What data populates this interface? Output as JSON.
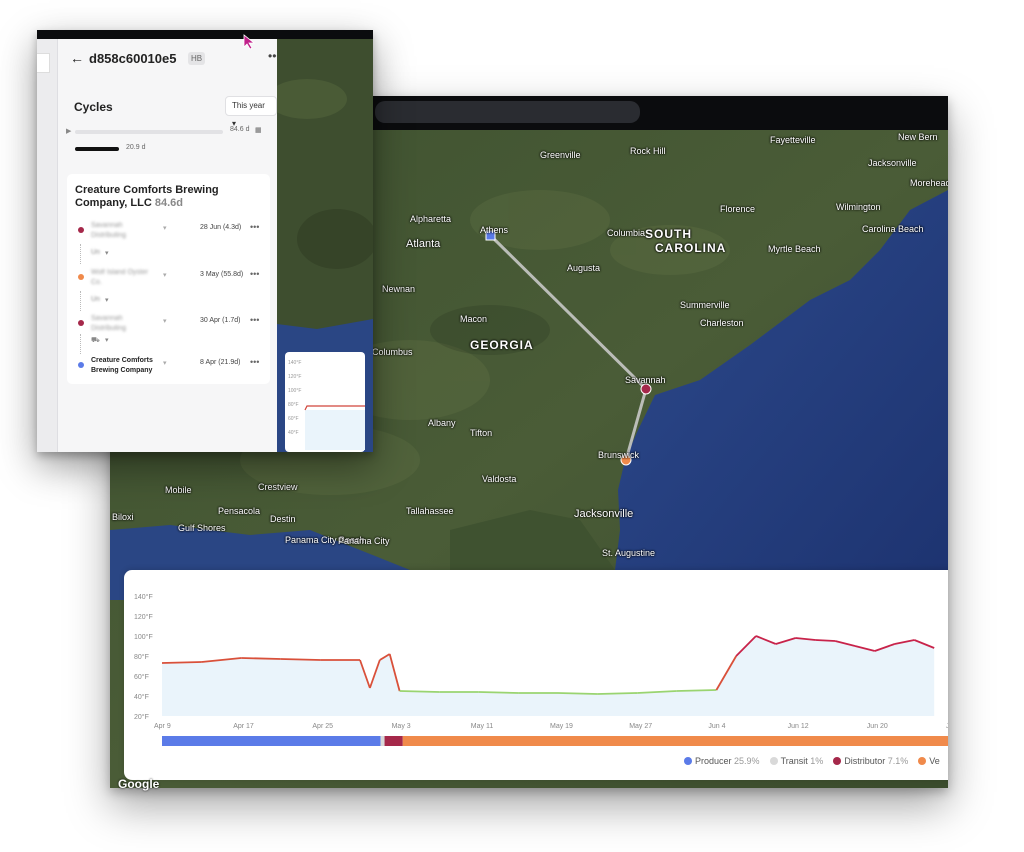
{
  "app": {
    "device_id": "d858c60010e5",
    "badge": "HB",
    "more_icon": "more-horizontal-icon",
    "back_icon": "arrow-left-icon"
  },
  "cycles": {
    "title": "Cycles",
    "period_select": "This year",
    "total_duration": "84.6 d",
    "progress_fraction": 1.0,
    "sub_duration": "20.9 d"
  },
  "company": {
    "name": "Creature Comforts Brewing Company, LLC",
    "days": "84.6d",
    "stops": [
      {
        "name": "Savannah Distributing",
        "date": "28 Jun (4.3d)",
        "color": "#a5284a",
        "blurred": true,
        "mode": "Un"
      },
      {
        "name": "Wolf Island Oyster Co.",
        "date": "3 May (55.8d)",
        "color": "#f08a4b",
        "blurred": true,
        "mode": "Un"
      },
      {
        "name": "Savannah Distributing",
        "date": "30 Apr (1.7d)",
        "color": "#a5284a",
        "blurred": true,
        "mode": "truck"
      },
      {
        "name": "Creature Comforts Brewing Company",
        "date": "8 Apr (21.9d)",
        "color": "#5b7be8",
        "blurred": false
      }
    ]
  },
  "mini_chart": {
    "y_ticks": [
      "140°F",
      "120°F",
      "100°F",
      "80°F",
      "60°F",
      "40°F"
    ]
  },
  "map": {
    "labels": {
      "states": [
        "SOUTH",
        "CAROLINA",
        "GEORGIA"
      ],
      "cities": [
        "Atlanta",
        "Athens",
        "Augusta",
        "Columbia",
        "Savannah",
        "Brunswick",
        "Jacksonville",
        "Tallahassee",
        "Macon",
        "Albany",
        "Tifton",
        "Valdosta",
        "Charleston",
        "Summerville",
        "Florence",
        "Wilmington",
        "Myrtle Beach",
        "Fayetteville",
        "Jacksonville",
        "Greenville",
        "Rock Hill",
        "Alpharetta",
        "Newnan",
        "Pensacola",
        "Mobile",
        "Destin",
        "Panama City Beach",
        "Panama City",
        "Gulf Shores",
        "Crestview",
        "St. Augustine",
        "Carolina Beach",
        "New Bern",
        "Morehead",
        "Biloxi",
        "Columbus"
      ],
      "google": "Google"
    }
  },
  "chart_data": {
    "type": "line",
    "title": "",
    "xlabel": "",
    "ylabel": "",
    "y_ticks": [
      "140°F",
      "120°F",
      "100°F",
      "80°F",
      "60°F",
      "40°F",
      "20°F"
    ],
    "ylim": [
      20,
      140
    ],
    "x_ticks": [
      "Apr 9",
      "Apr 17",
      "Apr 25",
      "May 3",
      "May 11",
      "May 19",
      "May 27",
      "Jun 4",
      "Jun 12",
      "Jun 20",
      "Jun 2"
    ],
    "series": [
      {
        "x": [
          "Apr 9",
          "Apr 13",
          "Apr 17",
          "Apr 21",
          "Apr 25",
          "Apr 29",
          "Apr 30",
          "May 1",
          "May 2",
          "May 3",
          "May 7",
          "May 11",
          "May 15",
          "May 19",
          "May 23",
          "May 27",
          "May 31",
          "Jun 4",
          "Jun 6",
          "Jun 8",
          "Jun 10",
          "Jun 12",
          "Jun 14",
          "Jun 16",
          "Jun 18",
          "Jun 20",
          "Jun 22",
          "Jun 24",
          "Jun 26"
        ],
        "values": [
          73,
          74,
          78,
          77,
          76,
          76,
          48,
          76,
          82,
          45,
          44,
          44,
          43,
          43,
          42,
          43,
          45,
          46,
          80,
          100,
          92,
          98,
          96,
          95,
          90,
          85,
          92,
          96,
          88
        ]
      }
    ],
    "segments": [
      {
        "label": "Producer",
        "pct": "25.9%",
        "color": "#5b7be8",
        "fraction": 0.276
      },
      {
        "label": "Transit",
        "pct": "1%",
        "color": "#d9d9d9",
        "fraction": 0.005
      },
      {
        "label": "Distributor",
        "pct": "7.1%",
        "color": "#a5284a",
        "fraction": 0.023
      },
      {
        "label": "Ve",
        "pct": "",
        "color": "#f08a4b",
        "fraction": 0.696
      }
    ],
    "grid": false
  }
}
